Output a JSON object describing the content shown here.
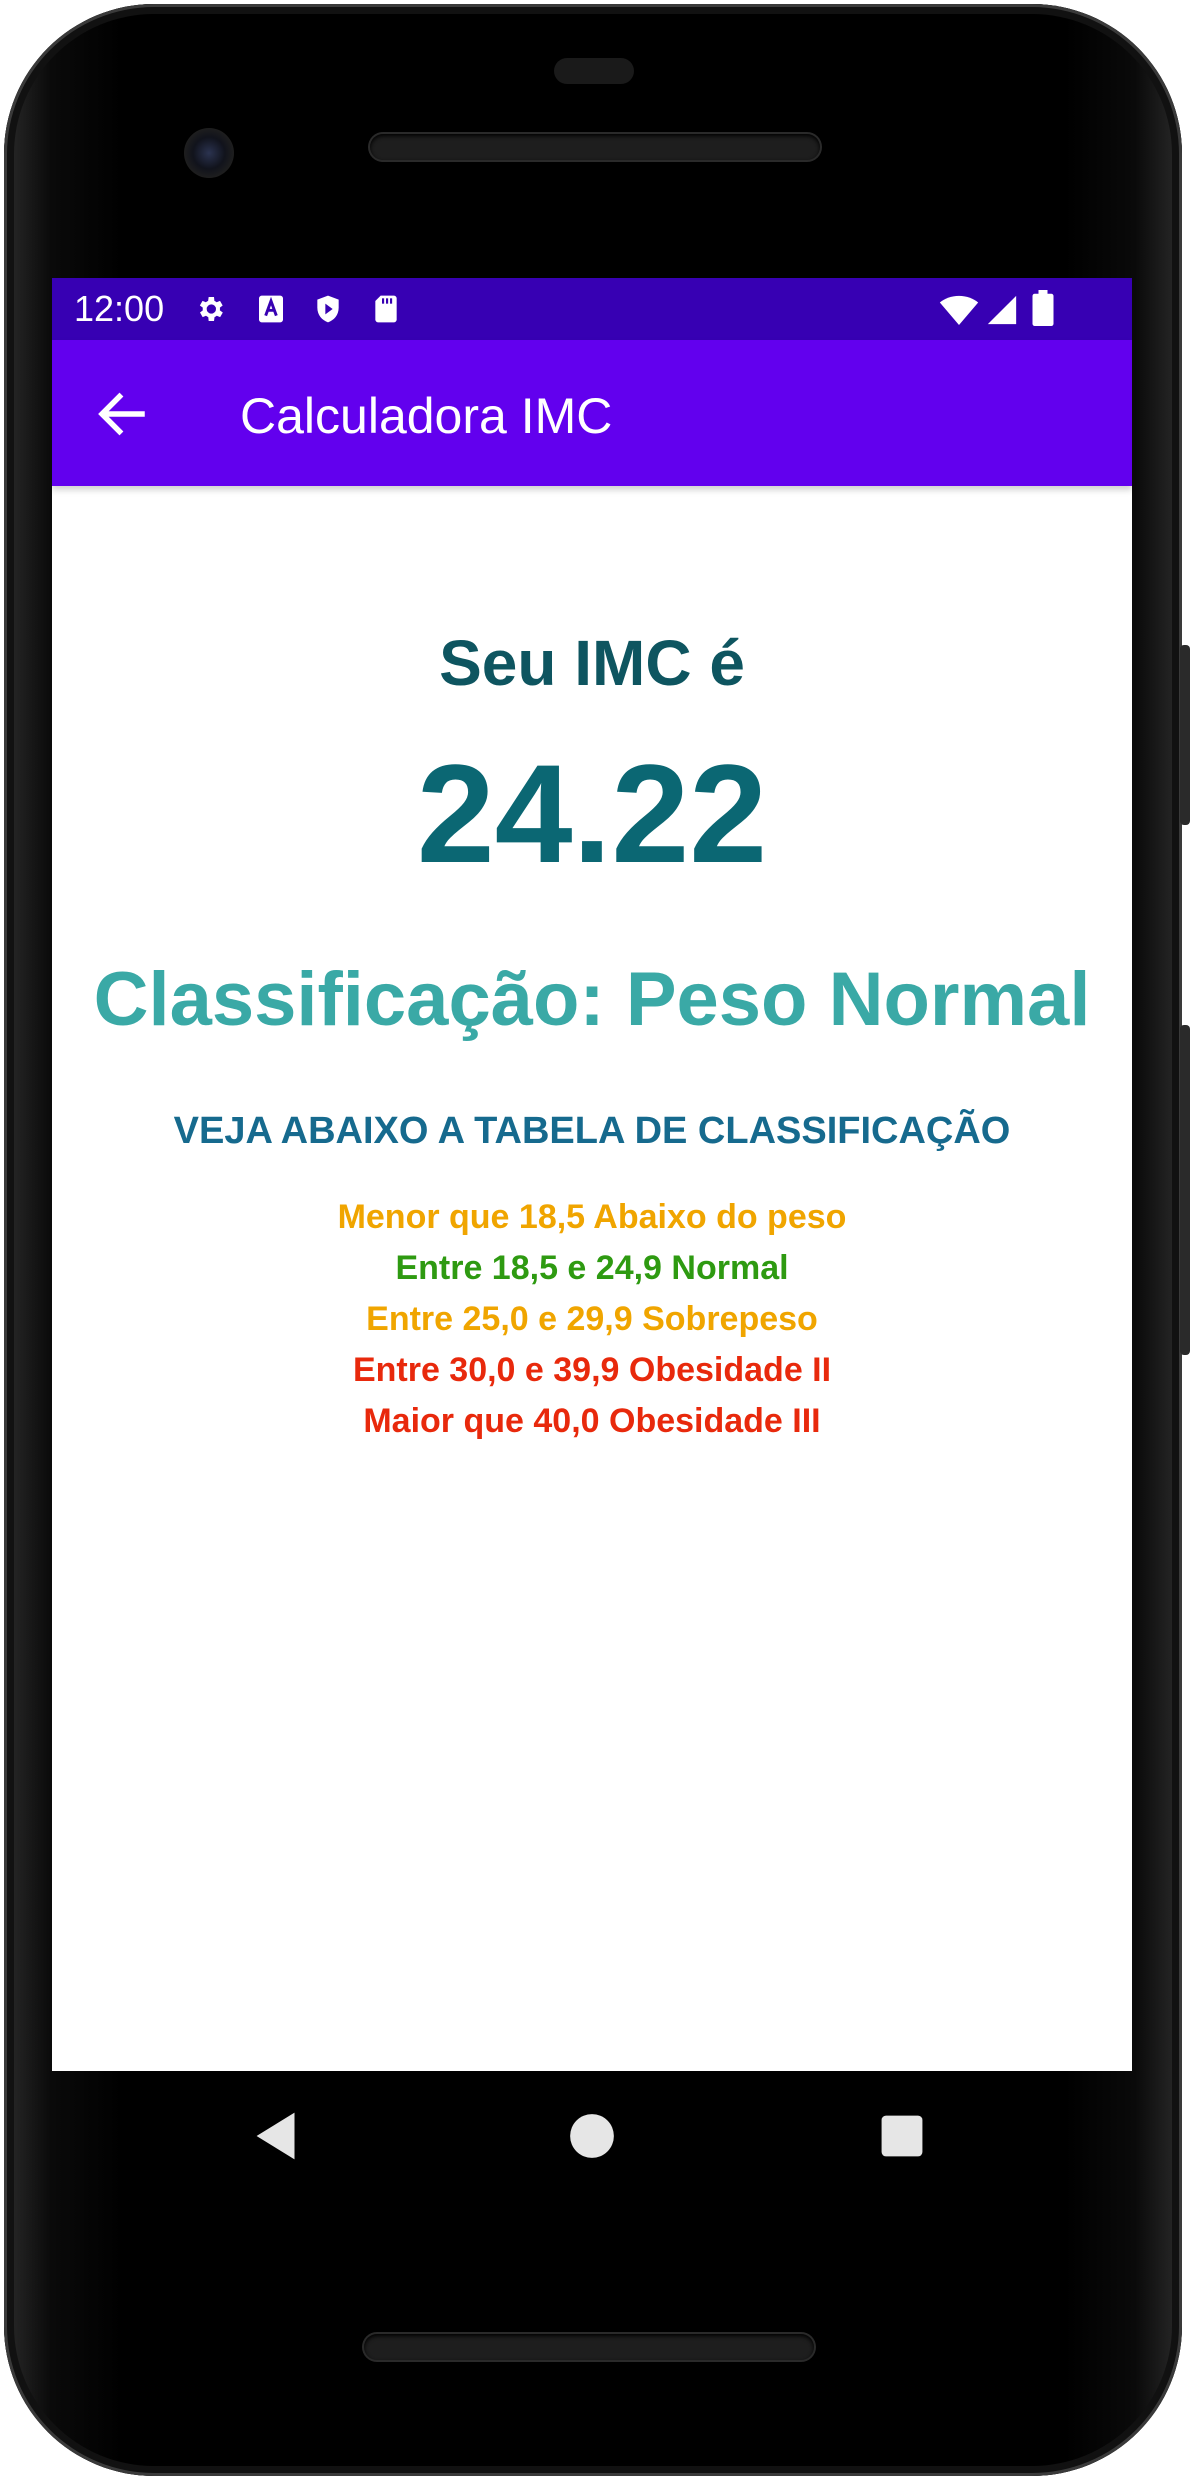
{
  "status_bar": {
    "time": "12:00",
    "left_icons": [
      "gear-icon",
      "font-a-icon",
      "shield-play-icon",
      "sd-card-icon"
    ],
    "right_icons": [
      "wifi-icon",
      "signal-icon",
      "battery-icon"
    ]
  },
  "app_bar": {
    "back_icon": "arrow-left-icon",
    "title": "Calculadora IMC"
  },
  "result": {
    "label": "Seu IMC é",
    "value": "24.22",
    "classification": "Classificação: Peso Normal"
  },
  "classification_table": {
    "heading": "VEJA ABAIXO A TABELA DE CLASSIFICAÇÃO",
    "rows": [
      {
        "text": "Menor que 18,5 Abaixo do peso",
        "color": "#F0A500"
      },
      {
        "text": "Entre 18,5 e 24,9 Normal",
        "color": "#2E9A11"
      },
      {
        "text": "Entre 25,0 e 29,9 Sobrepeso",
        "color": "#F0A500"
      },
      {
        "text": "Entre 30,0 e 39,9 Obesidade II",
        "color": "#E8290C"
      },
      {
        "text": "Maior que 40,0 Obesidade III",
        "color": "#E8290C"
      }
    ]
  },
  "nav_bar": {
    "icons": [
      "back-triangle-icon",
      "home-circle-icon",
      "recents-square-icon"
    ]
  },
  "colors": {
    "status_bar": "#3700B3",
    "app_bar": "#6200EE",
    "result_value": "#0B6773",
    "classification": "#3AA9A6",
    "table_heading": "#166A8E"
  }
}
